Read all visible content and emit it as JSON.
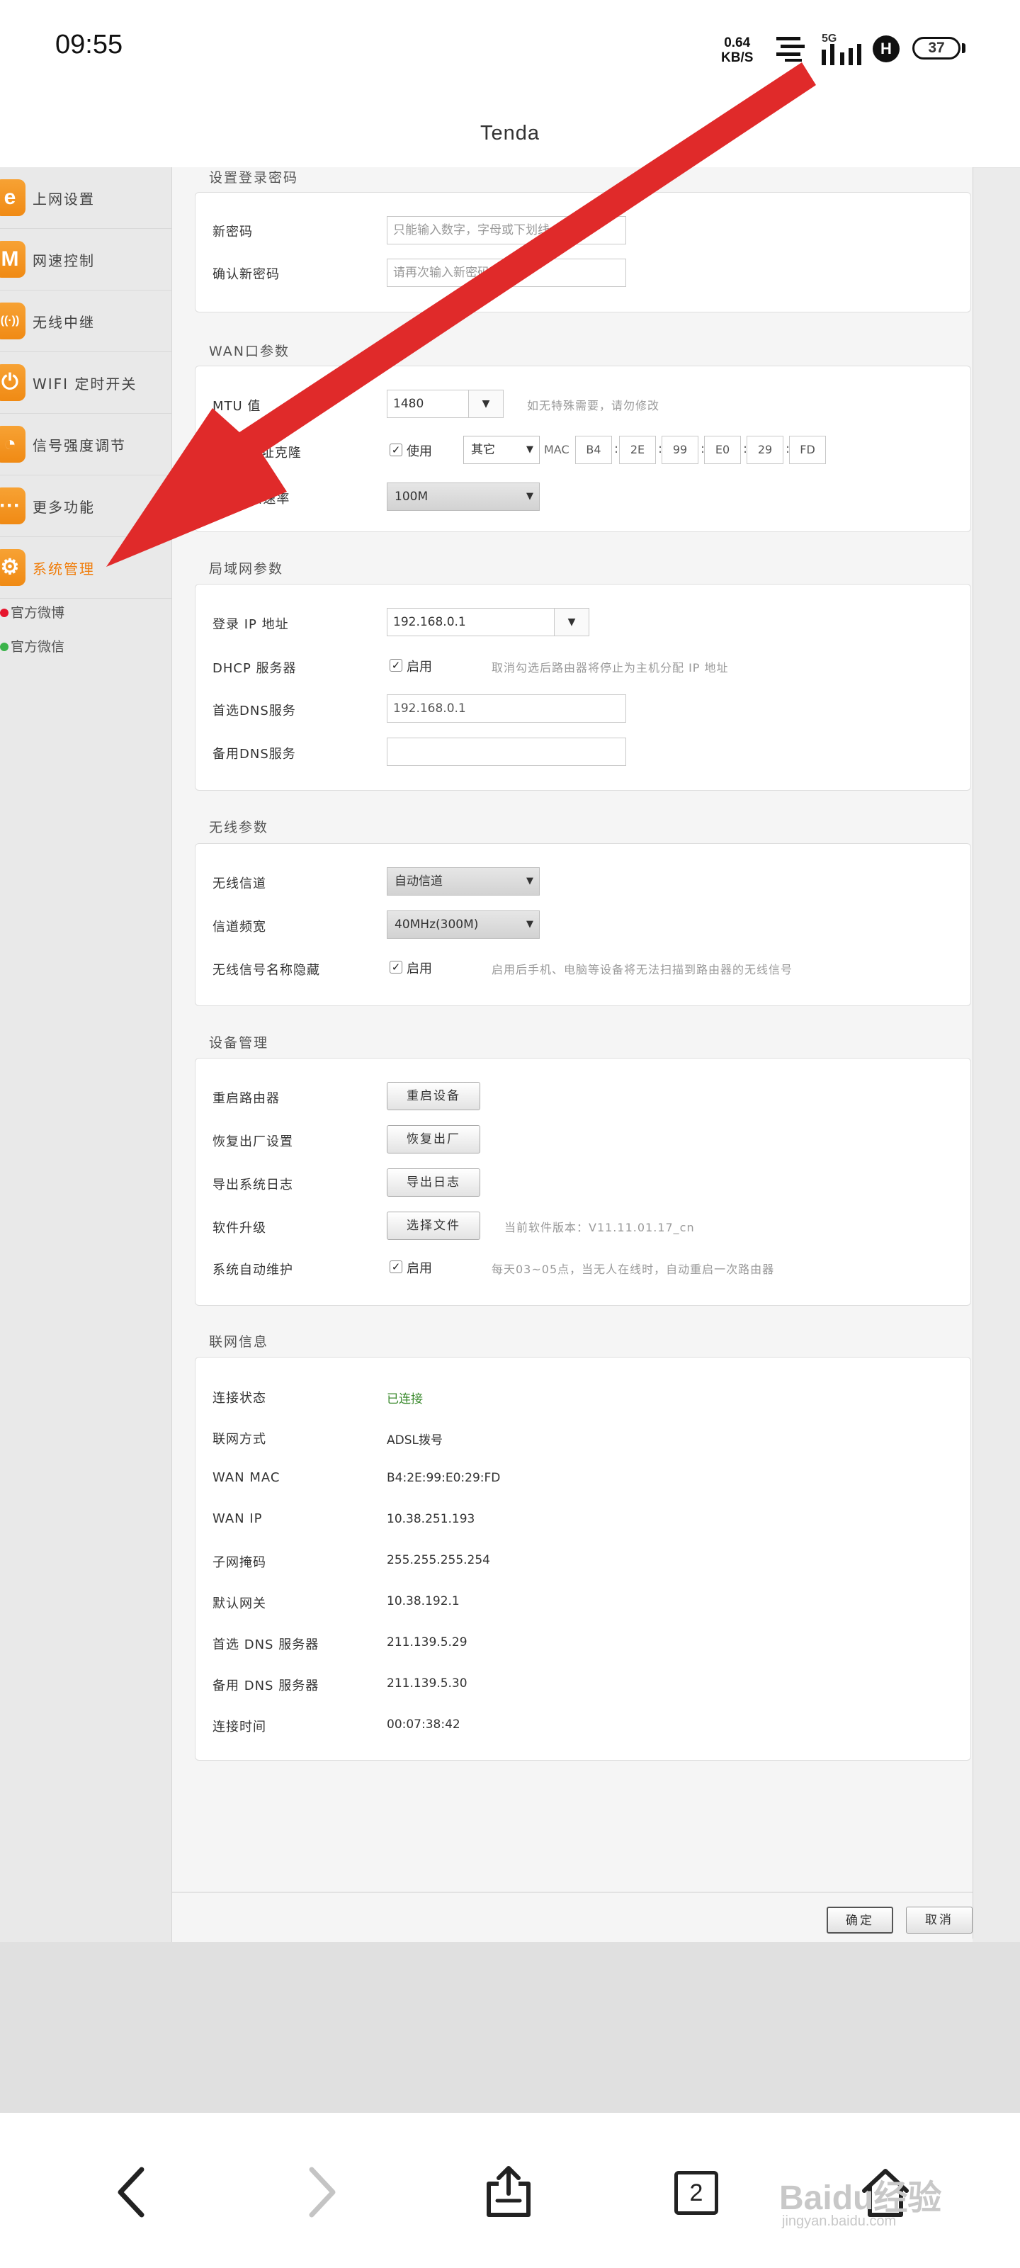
{
  "status_bar": {
    "time": "09:55",
    "net_speed": "0.64",
    "net_unit": "KB/S",
    "network": "5G",
    "hd": "H",
    "battery": "37"
  },
  "header": {
    "title": "Tenda"
  },
  "sidebar": {
    "items": [
      {
        "label": "上网设置",
        "icon": "e"
      },
      {
        "label": "网速控制",
        "icon": "M"
      },
      {
        "label": "无线中继",
        "icon": "((·))"
      },
      {
        "label": "WIFI 定时开关",
        "icon": "⏻"
      },
      {
        "label": "信号强度调节",
        "icon": "◔"
      },
      {
        "label": "更多功能",
        "icon": "···"
      },
      {
        "label": "系统管理",
        "icon": "⚙"
      }
    ],
    "social": [
      "官方微博",
      "官方微信"
    ]
  },
  "password": {
    "section": "设置登录密码",
    "new_label": "新密码",
    "new_placeholder": "只能输入数字，字母或下划线",
    "confirm_label": "确认新密码",
    "confirm_placeholder": "请再次输入新密码"
  },
  "wan": {
    "section": "WAN口参数",
    "mtu_label": "MTU 值",
    "mtu_value": "1480",
    "mtu_hint": "如无特殊需要，请勿修改",
    "mac_label": "MAC 地址克隆",
    "mac_use": "使用",
    "mac_mode": "其它",
    "mac_prefix": "MAC",
    "mac_bytes": [
      "B4",
      "2E",
      "99",
      "E0",
      "29",
      "FD"
    ],
    "speed_label": "WAN 口速率",
    "speed_value": "100M"
  },
  "lan": {
    "section": "局域网参数",
    "ip_label": "登录 IP 地址",
    "ip_value": "192.168.0.1",
    "dhcp_label": "DHCP 服务器",
    "dhcp_enable": "启用",
    "dhcp_hint": "取消勾选后路由器将停止为主机分配 IP 地址",
    "dns1_label": "首选DNS服务",
    "dns1_value": "192.168.0.1",
    "dns2_label": "备用DNS服务",
    "dns2_value": ""
  },
  "wireless": {
    "section": "无线参数",
    "channel_label": "无线信道",
    "channel_value": "自动信道",
    "bandwidth_label": "信道频宽",
    "bandwidth_value": "40MHz(300M)",
    "hide_label": "无线信号名称隐藏",
    "hide_enable": "启用",
    "hide_hint": "启用后手机、电脑等设备将无法扫描到路由器的无线信号"
  },
  "device": {
    "section": "设备管理",
    "reboot_label": "重启路由器",
    "reboot_btn": "重启设备",
    "reset_label": "恢复出厂设置",
    "reset_btn": "恢复出厂",
    "export_label": "导出系统日志",
    "export_btn": "导出日志",
    "upgrade_label": "软件升级",
    "upgrade_btn": "选择文件",
    "version_text": "当前软件版本：V11.11.01.17_cn",
    "auto_label": "系统自动维护",
    "auto_enable": "启用",
    "auto_hint": "每天03~05点，当无人在线时，自动重启一次路由器"
  },
  "netinfo": {
    "section": "联网信息",
    "rows": [
      {
        "label": "连接状态",
        "value": "已连接"
      },
      {
        "label": "联网方式",
        "value": "ADSL拨号"
      },
      {
        "label": "WAN MAC",
        "value": "B4:2E:99:E0:29:FD"
      },
      {
        "label": "WAN IP",
        "value": "10.38.251.193"
      },
      {
        "label": "子网掩码",
        "value": "255.255.255.254"
      },
      {
        "label": "默认网关",
        "value": "10.38.192.1"
      },
      {
        "label": "首选 DNS 服务器",
        "value": "211.139.5.29"
      },
      {
        "label": "备用 DNS 服务器",
        "value": "211.139.5.30"
      },
      {
        "label": "连接时间",
        "value": "00:07:38:42"
      }
    ]
  },
  "footer": {
    "ok": "确定",
    "cancel": "取消"
  },
  "bottom_nav": {
    "tabs_count": "2",
    "watermark": "Baidu经验",
    "watermark_sub": "jingyan.baidu.com"
  },
  "colors": {
    "accent": "#f07d0a",
    "annotation_arrow": "#e02a2a",
    "status_ok": "#3b8a2e"
  }
}
